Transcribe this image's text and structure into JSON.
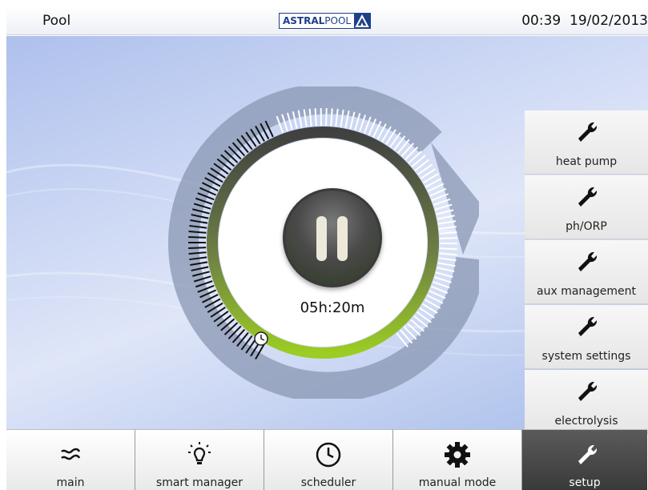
{
  "header": {
    "title": "Pool",
    "logo_bold": "ASTRAL",
    "logo_light": "POOL",
    "time": "00:39",
    "date": "19/02/2013"
  },
  "dial": {
    "remaining_time": "05h:20m",
    "button_state": "paused",
    "colors": {
      "accent": "#9ccd22",
      "ring": "#8a97b3",
      "inactive_track": "#ffffff",
      "elapsed_track": "#111111"
    }
  },
  "side_menu": {
    "items": [
      {
        "label": "heat pump",
        "icon": "wrench-icon"
      },
      {
        "label": "ph/ORP",
        "icon": "wrench-icon"
      },
      {
        "label": "aux management",
        "icon": "wrench-icon"
      },
      {
        "label": "system settings",
        "icon": "wrench-icon"
      },
      {
        "label": "electrolysis",
        "icon": "wrench-icon"
      }
    ]
  },
  "bottom_nav": {
    "items": [
      {
        "label": "main",
        "icon": "waves-icon"
      },
      {
        "label": "smart manager",
        "icon": "lightbulb-icon"
      },
      {
        "label": "scheduler",
        "icon": "clock-icon"
      },
      {
        "label": "manual mode",
        "icon": "gear-icon"
      },
      {
        "label": "setup",
        "icon": "wrench-icon",
        "active": true
      }
    ]
  }
}
